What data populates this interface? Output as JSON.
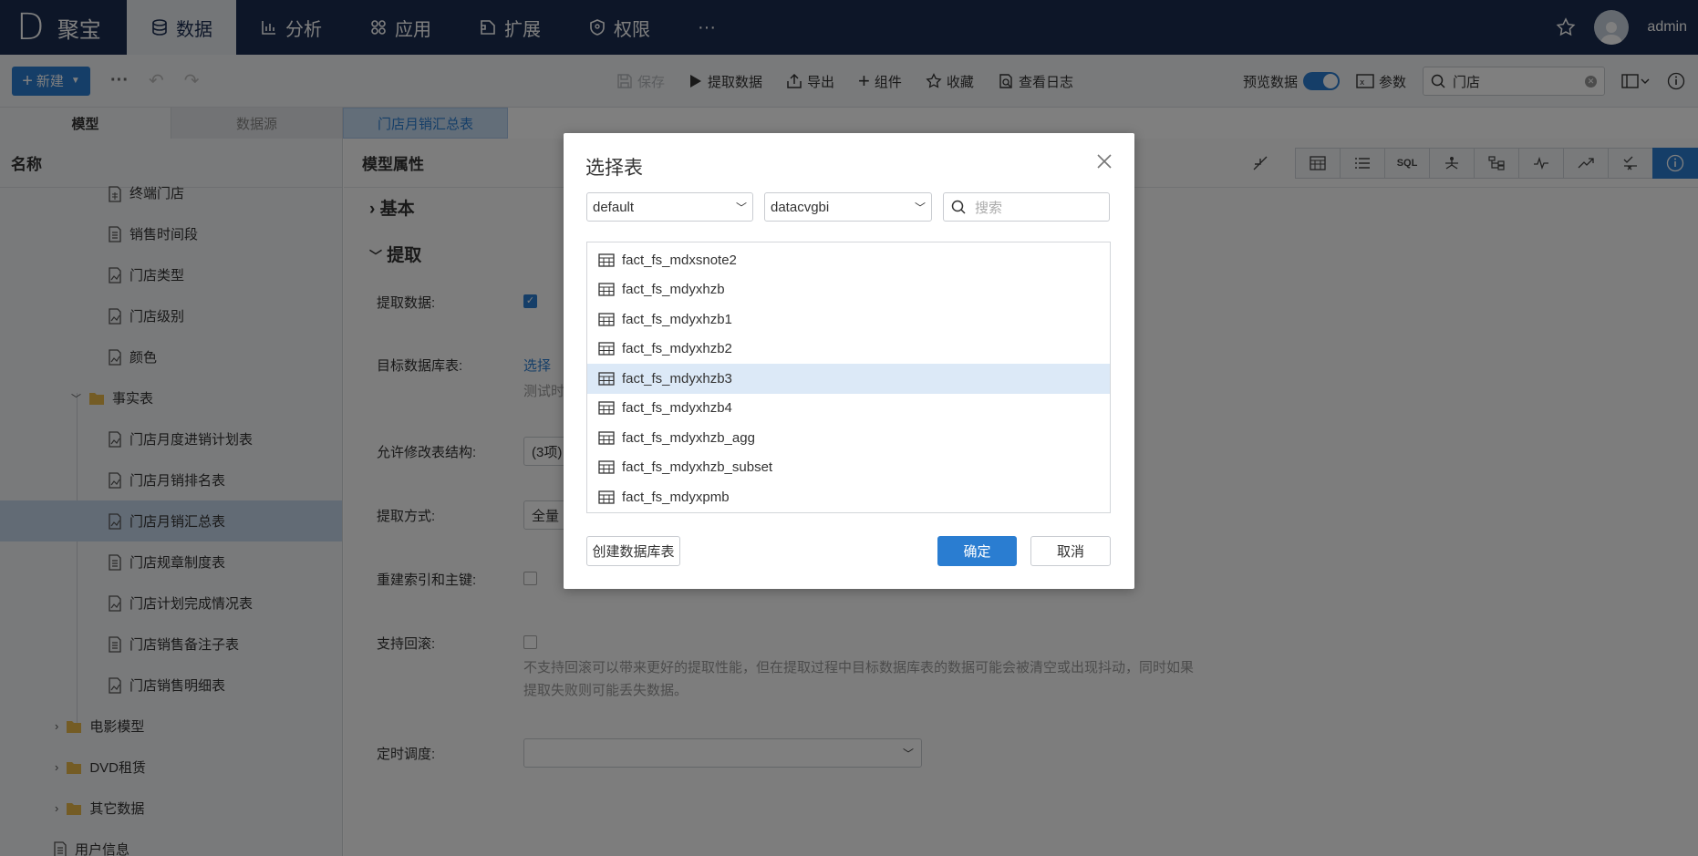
{
  "app": {
    "logo_letter": "D",
    "logo_text": "聚宝"
  },
  "nav": {
    "items": [
      {
        "label": "数据",
        "icon": "database-icon"
      },
      {
        "label": "分析",
        "icon": "bar-chart-icon"
      },
      {
        "label": "应用",
        "icon": "apps-icon"
      },
      {
        "label": "扩展",
        "icon": "extension-icon"
      },
      {
        "label": "权限",
        "icon": "shield-icon"
      }
    ],
    "more": "···",
    "user": "admin"
  },
  "toolbar": {
    "new_label": "新建",
    "save": "保存",
    "extract": "提取数据",
    "export": "导出",
    "component": "组件",
    "favorite": "收藏",
    "log": "查看日志",
    "preview": "预览数据",
    "params": "参数",
    "search_value": "门店"
  },
  "tabs": {
    "model": "模型",
    "datasource": "数据源",
    "doc": "门店月销汇总表"
  },
  "left": {
    "title": "名称",
    "items": [
      {
        "label": "终端门店"
      },
      {
        "label": "销售时间段"
      },
      {
        "label": "门店类型"
      },
      {
        "label": "门店级别"
      },
      {
        "label": "颜色"
      },
      {
        "label": "事实表"
      },
      {
        "label": "门店月度进销计划表"
      },
      {
        "label": "门店月销排名表"
      },
      {
        "label": "门店月销汇总表"
      },
      {
        "label": "门店规章制度表"
      },
      {
        "label": "门店计划完成情况表"
      },
      {
        "label": "门店销售备注子表"
      },
      {
        "label": "门店销售明细表"
      },
      {
        "label": "电影模型"
      },
      {
        "label": "DVD租赁"
      },
      {
        "label": "其它数据"
      },
      {
        "label": "用户信息"
      }
    ]
  },
  "main": {
    "title": "模型属性",
    "view_sql": "SQL",
    "section_basic": "基本",
    "section_extract": "提取",
    "extract_data_label": "提取数据:",
    "target_table_label": "目标数据库表:",
    "target_link": "选择",
    "target_hint": "测试时",
    "allow_modify_label": "允许修改表结构:",
    "allow_modify_value": "(3项)",
    "extract_mode_label": "提取方式:",
    "extract_mode_value": "全量",
    "rebuild_label": "重建索引和主键:",
    "rollback_label": "支持回滚:",
    "rollback_hint": "不支持回滚可以带来更好的提取性能，但在提取过程中目标数据库表的数据可能会被清空或出现抖动，同时如果提取失败则可能丢失数据。",
    "schedule_label": "定时调度:"
  },
  "dialog": {
    "title": "选择表",
    "schema": "default",
    "database": "datacvgbi",
    "search_placeholder": "搜索",
    "tables": [
      "fact_fs_mdxsnote2",
      "fact_fs_mdyxhzb",
      "fact_fs_mdyxhzb1",
      "fact_fs_mdyxhzb2",
      "fact_fs_mdyxhzb3",
      "fact_fs_mdyxhzb4",
      "fact_fs_mdyxhzb_agg",
      "fact_fs_mdyxhzb_subset",
      "fact_fs_mdyxpmb"
    ],
    "selected_index": 4,
    "create_btn": "创建数据库表",
    "ok_btn": "确定",
    "cancel_btn": "取消"
  }
}
